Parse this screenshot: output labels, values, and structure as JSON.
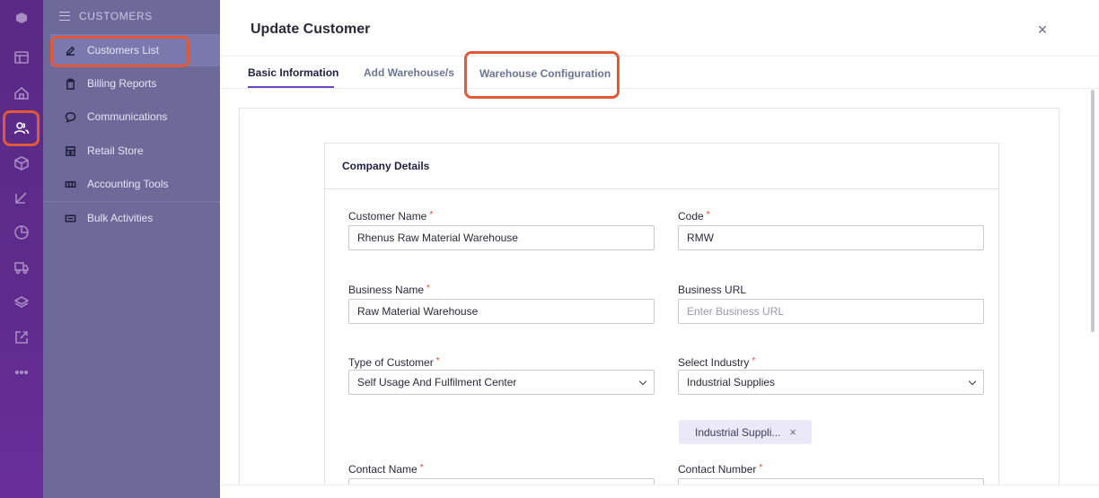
{
  "rail": {
    "icons": [
      "logo-icon",
      "dashboard-icon",
      "home-icon",
      "users-icon",
      "cube-icon",
      "import-icon",
      "pie-chart-icon",
      "truck-icon",
      "layers-icon",
      "external-link-icon",
      "more-icon"
    ],
    "active": "users-icon"
  },
  "sidebar": {
    "section": "CUSTOMERS",
    "items": [
      {
        "label": "Customers List",
        "icon": "edit-icon"
      },
      {
        "label": "Billing Reports",
        "icon": "clipboard-icon"
      },
      {
        "label": "Communications",
        "icon": "chat-icon"
      },
      {
        "label": "Retail Store",
        "icon": "store-icon"
      },
      {
        "label": "Accounting Tools",
        "icon": "accounting-icon"
      },
      {
        "label": "Bulk Activities",
        "icon": "bulk-icon"
      }
    ]
  },
  "modal": {
    "title": "Update Customer",
    "close_symbol": "×",
    "tabs": [
      {
        "label": "Basic Information",
        "active": true
      },
      {
        "label": "Add Warehouse/s",
        "active": false
      },
      {
        "label": "Warehouse Configuration",
        "active": false
      }
    ]
  },
  "company": {
    "title": "Company Details",
    "customer_name": {
      "label": "Customer Name",
      "value": "Rhenus Raw Material Warehouse",
      "required": "*"
    },
    "code": {
      "label": "Code",
      "value": "RMW",
      "required": "*"
    },
    "business_name": {
      "label": "Business Name",
      "value": "Raw Material Warehouse",
      "required": "*"
    },
    "business_url": {
      "label": "Business URL",
      "value": "",
      "placeholder": "Enter Business URL"
    },
    "customer_type": {
      "label": "Type of Customer",
      "value": "Self Usage And Fulfilment Center",
      "required": "*"
    },
    "industry": {
      "label": "Select Industry",
      "value": "Industrial Supplies",
      "required": "*"
    },
    "industry_chip": {
      "label": "Industrial Suppli...",
      "remove": "×"
    },
    "contact_name": {
      "label": "Contact Name",
      "required": "*"
    },
    "contact_number": {
      "label": "Contact Number",
      "required": "*"
    }
  },
  "colors": {
    "rail": "#5e2b8c",
    "highlight": "#e05a3a",
    "tab_accent": "#6a4bc4",
    "required": "#e0483a"
  }
}
